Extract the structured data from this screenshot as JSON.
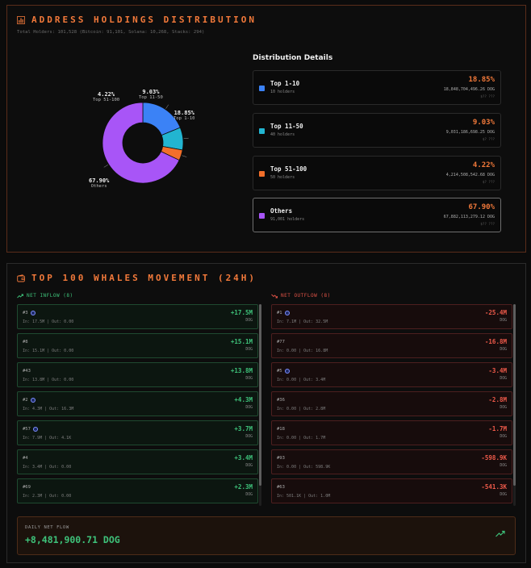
{
  "holdings": {
    "title": "ADDRESS HOLDINGS DISTRIBUTION",
    "subtitle": "Total Holders: 101,528 (Bitcoin: 91,101, Solana: 10,268, Stacks: 294)",
    "details_title": "Distribution Details",
    "segments": [
      {
        "name": "Top 1-10",
        "holders": "10 holders",
        "percent": "18.85%",
        "value": 18.85,
        "amount": "18,848,704,496.26 DOG",
        "usd": "$?? ???",
        "color": "#3b82f6",
        "donut_pct": "18.85%",
        "donut_name": "Top 1-10"
      },
      {
        "name": "Top 11-50",
        "holders": "40 holders",
        "percent": "9.03%",
        "value": 9.03,
        "amount": "9,031,186,698.25 DOG",
        "usd": "$? ???",
        "color": "#22b5d1",
        "donut_pct": "9.03%",
        "donut_name": "Top 11-50"
      },
      {
        "name": "Top 51-100",
        "holders": "50 holders",
        "percent": "4.22%",
        "value": 4.22,
        "amount": "4,214,508,542.68 DOG",
        "usd": "$? ???",
        "color": "#f26f2a",
        "donut_pct": "4.22%",
        "donut_name": "Top 51-100"
      },
      {
        "name": "Others",
        "holders": "91,001 holders",
        "percent": "67.90%",
        "value": 67.9,
        "amount": "67,882,113,279.12 DOG",
        "usd": "$?? ???",
        "color": "#a855f7",
        "donut_pct": "67.90%",
        "donut_name": "Others"
      }
    ]
  },
  "whales": {
    "title": "TOP 100 WHALES MOVEMENT (24H)",
    "inflow_label": "NET INFLOW (8)",
    "outflow_label": "NET OUTFLOW (8)",
    "inflow": [
      {
        "rank": "#3",
        "icon": true,
        "detail": "In: 17.5M | Out: 0.00",
        "value": "+17.5M",
        "token": "DOG"
      },
      {
        "rank": "#8",
        "icon": false,
        "detail": "In: 15.1M | Out: 0.00",
        "value": "+15.1M",
        "token": "DOG"
      },
      {
        "rank": "#43",
        "icon": false,
        "detail": "In: 13.8M | Out: 0.00",
        "value": "+13.8M",
        "token": "DOG"
      },
      {
        "rank": "#2",
        "icon": true,
        "detail": "In: 4.3M | Out: 16.3M",
        "value": "+4.3M",
        "token": "DOG"
      },
      {
        "rank": "#57",
        "icon": true,
        "detail": "In: 7.9M | Out: 4.1K",
        "value": "+3.7M",
        "token": "DOG"
      },
      {
        "rank": "#4",
        "icon": false,
        "detail": "In: 3.4M | Out: 0.00",
        "value": "+3.4M",
        "token": "DOG"
      },
      {
        "rank": "#69",
        "icon": false,
        "detail": "In: 2.3M | Out: 0.00",
        "value": "+2.3M",
        "token": "DOG"
      }
    ],
    "outflow": [
      {
        "rank": "#1",
        "icon": true,
        "detail": "In: 7.1M | Out: 32.5M",
        "value": "-25.4M",
        "token": "DOG"
      },
      {
        "rank": "#77",
        "icon": false,
        "detail": "In: 0.00 | Out: 16.8M",
        "value": "-16.8M",
        "token": "DOG"
      },
      {
        "rank": "#5",
        "icon": true,
        "detail": "In: 0.00 | Out: 3.4M",
        "value": "-3.4M",
        "token": "DOG"
      },
      {
        "rank": "#36",
        "icon": false,
        "detail": "In: 0.00 | Out: 2.8M",
        "value": "-2.8M",
        "token": "DOG"
      },
      {
        "rank": "#18",
        "icon": false,
        "detail": "In: 0.00 | Out: 1.7M",
        "value": "-1.7M",
        "token": "DOG"
      },
      {
        "rank": "#93",
        "icon": false,
        "detail": "In: 0.00 | Out: 598.9K",
        "value": "-598.9K",
        "token": "DOG"
      },
      {
        "rank": "#63",
        "icon": false,
        "detail": "In: 501.1K | Out: 1.0M",
        "value": "-541.3K",
        "token": "DOG"
      }
    ],
    "daily_label": "DAILY NET FLOW",
    "daily_value": "+8,481,900.71 DOG"
  },
  "colors": {
    "accent": "#f2793a",
    "inflow": "#3ec27a",
    "outflow": "#ef5a4a"
  }
}
